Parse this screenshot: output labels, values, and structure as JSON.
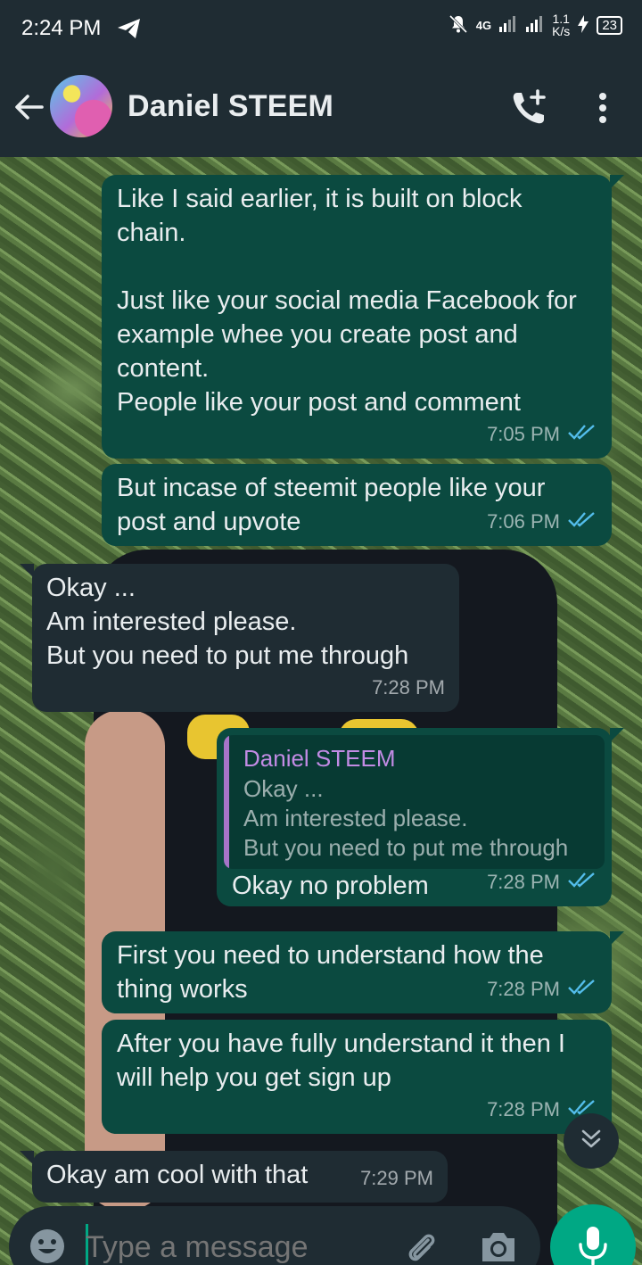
{
  "status_bar": {
    "time": "2:24 PM",
    "network": "4G",
    "speed_value": "1.1",
    "speed_unit": "K/s",
    "battery": "23"
  },
  "header": {
    "contact_name": "Daniel STEEM",
    "icons": [
      "back-arrow-icon",
      "add-call-icon",
      "more-vert-icon"
    ]
  },
  "messages": [
    {
      "direction": "out",
      "text": "Like I said earlier, it is built on block chain.\n\nJust like your social media Facebook for example whee you create post and content.\nPeople like your post and comment",
      "time": "7:05 PM",
      "status": "read"
    },
    {
      "direction": "out",
      "text": "But incase of steemit people like your post and upvote",
      "time": "7:06 PM",
      "status": "read"
    },
    {
      "direction": "in",
      "text": "Okay ...\nAm interested please.\nBut you need to put me through",
      "time": "7:28 PM"
    },
    {
      "direction": "out",
      "quote": {
        "author": "Daniel STEEM",
        "text": "Okay ...\nAm interested please.\nBut you need to put me through"
      },
      "text": "Okay no problem",
      "time": "7:28 PM",
      "status": "read"
    },
    {
      "direction": "out",
      "text": "First you need to understand how the thing works",
      "time": "7:28 PM",
      "status": "read"
    },
    {
      "direction": "out",
      "text": "After you have fully understand it then I will help you get sign up",
      "time": "7:28 PM",
      "status": "read"
    },
    {
      "direction": "in",
      "text": "Okay am cool with that",
      "time": "7:29 PM"
    }
  ],
  "composer": {
    "placeholder": "Type a message",
    "icons": [
      "emoji-icon",
      "attach-icon",
      "camera-icon",
      "mic-icon"
    ]
  },
  "colors": {
    "header_bg": "#1f2c33",
    "outgoing_bubble": "#0b4a40",
    "incoming_bubble": "#1f2c33",
    "read_ticks": "#53bdeb",
    "accent": "#00a884",
    "quote_author": "#c28be4"
  }
}
